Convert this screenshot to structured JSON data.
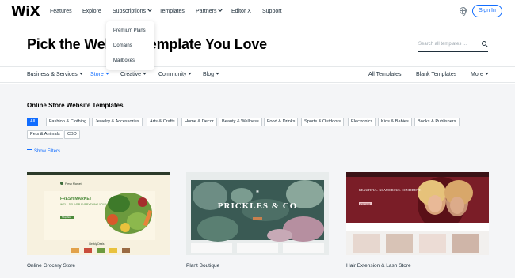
{
  "brand": {
    "logo": "WiX"
  },
  "topnav": {
    "items": [
      "Features",
      "Explore",
      "Subscriptions",
      "Templates",
      "Partners",
      "Editor X",
      "Support"
    ],
    "signin": "Sign In"
  },
  "subscriptions_menu": [
    "Premium Plans",
    "Domains",
    "Mailboxes"
  ],
  "hero": {
    "title": "Pick the Website Template You Love",
    "search_placeholder": "Search all templates ..."
  },
  "categories": {
    "left": [
      "Business & Services",
      "Store",
      "Creative",
      "Community",
      "Blog"
    ],
    "active": "Store",
    "right": [
      "All Templates",
      "Blank Templates",
      "More"
    ]
  },
  "section": {
    "title": "Online Store Website Templates",
    "tags": [
      "All",
      "Fashion & Clothing",
      "Jewelry & Accessories",
      "Arts & Crafts",
      "Home & Decor",
      "Beauty & Wellness",
      "Food & Drinks",
      "Sports & Outdoors",
      "Electronics",
      "Kids & Babies",
      "Books & Publishers",
      "Pets & Animals",
      "CBD"
    ],
    "show_filters": "Show Filters"
  },
  "templates": [
    {
      "name": "Online Grocery Store",
      "preview": {
        "site": "Fresh Market",
        "headline": "FRESH MARKET",
        "tagline": "WE'LL DELIVER EVERYTHING YOU NEED",
        "button": "Shop Now",
        "sub": "Weekly Deals"
      }
    },
    {
      "name": "Plant Boutique",
      "preview": {
        "headline": "PRICKLES & CO"
      }
    },
    {
      "name": "Hair Extension & Lash Store",
      "preview": {
        "headline": "BEAUTIFUL. GLAMOROUS. CONFIDENT.",
        "button": "SHOP NOW"
      }
    }
  ],
  "colors": {
    "accent": "#116dff",
    "text": "#20303c",
    "section_bg": "#f4f5f7"
  }
}
